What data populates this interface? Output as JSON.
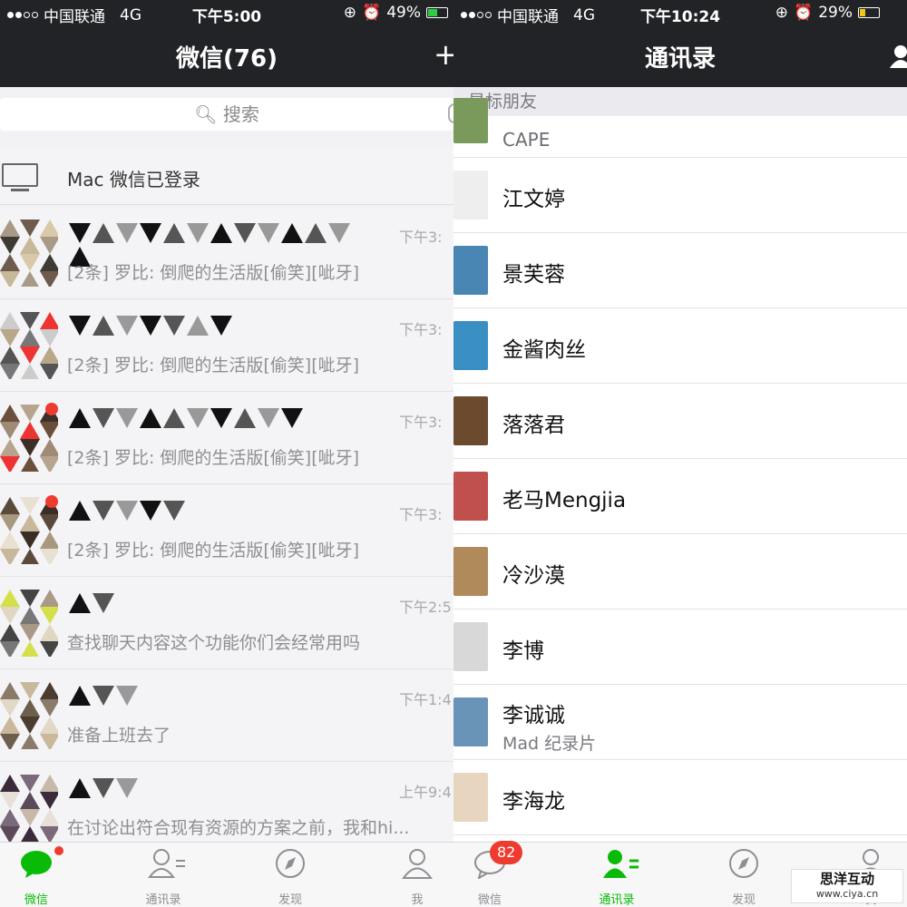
{
  "left": {
    "status": {
      "carrier": "中国联通",
      "network": "4G",
      "time": "下午5:00",
      "battery": "49%",
      "battery_fill": 0.49,
      "battery_color": "#2ecc40"
    },
    "nav": {
      "title": "微信(76)",
      "action": "+"
    },
    "search": {
      "placeholder": "搜索"
    },
    "mac_login": {
      "label": "Mac 微信已登录"
    },
    "chats": [
      {
        "time": "下午3:",
        "preview": "[2条] 罗比: 倒爬的生活版[偷笑][呲牙]"
      },
      {
        "time": "下午3:",
        "preview": "[2条] 罗比: 倒爬的生活版[偷笑][呲牙]"
      },
      {
        "time": "下午3:",
        "preview": "[2条] 罗比: 倒爬的生活版[偷笑][呲牙]"
      },
      {
        "time": "下午3:",
        "preview": "[2条] 罗比: 倒爬的生活版[偷笑][呲牙]"
      },
      {
        "time": "下午2:5",
        "preview": "查找聊天内容这个功能你们会经常用吗"
      },
      {
        "time": "下午1:4",
        "preview": "准备上班去了"
      },
      {
        "time": "上午9:4",
        "preview": "在讨论出符合现有资源的方案之前，我和hi..."
      }
    ],
    "tabs": [
      {
        "label": "微信",
        "active": true
      },
      {
        "label": "通讯录",
        "active": false
      },
      {
        "label": "发现",
        "active": false
      },
      {
        "label": "我",
        "active": false
      }
    ]
  },
  "right": {
    "status": {
      "carrier": "中国联通",
      "network": "4G",
      "time": "下午10:24",
      "battery": "29%",
      "battery_fill": 0.29,
      "battery_color": "#f5c518"
    },
    "nav": {
      "title": "通讯录"
    },
    "section": "星标朋友",
    "contacts": [
      {
        "name": "CAPE",
        "sub": "",
        "avatar_color": "#7a9a5c"
      },
      {
        "name": "江文婷",
        "sub": "",
        "avatar_color": "#eeeeee"
      },
      {
        "name": "景芙蓉",
        "sub": "",
        "avatar_color": "#4a86b4"
      },
      {
        "name": "金酱肉丝",
        "sub": "",
        "avatar_color": "#3a8fc2"
      },
      {
        "name": "落落君",
        "sub": "",
        "avatar_color": "#6b4a2e"
      },
      {
        "name": "老马Mengjia",
        "sub": "",
        "avatar_color": "#c0504d"
      },
      {
        "name": "冷沙漠",
        "sub": "",
        "avatar_color": "#b08a5a"
      },
      {
        "name": "李博",
        "sub": "",
        "avatar_color": "#d8d8d8"
      },
      {
        "name": "李诚诚",
        "sub": "Mad 纪录片",
        "avatar_color": "#6a93b8"
      },
      {
        "name": "李海龙",
        "sub": "",
        "avatar_color": "#e8d5c0"
      }
    ],
    "tabs": [
      {
        "label": "微信",
        "badge": "82",
        "active": false
      },
      {
        "label": "通讯录",
        "active": true
      },
      {
        "label": "发现",
        "active": false
      },
      {
        "label": "我",
        "active": false
      }
    ]
  },
  "watermark": {
    "line1": "思洋互动",
    "line2": "www.ciya.cn"
  },
  "colors": {
    "accent_green": "#09bb07",
    "nav_bg": "#222326",
    "badge_red": "#ee3b30"
  }
}
